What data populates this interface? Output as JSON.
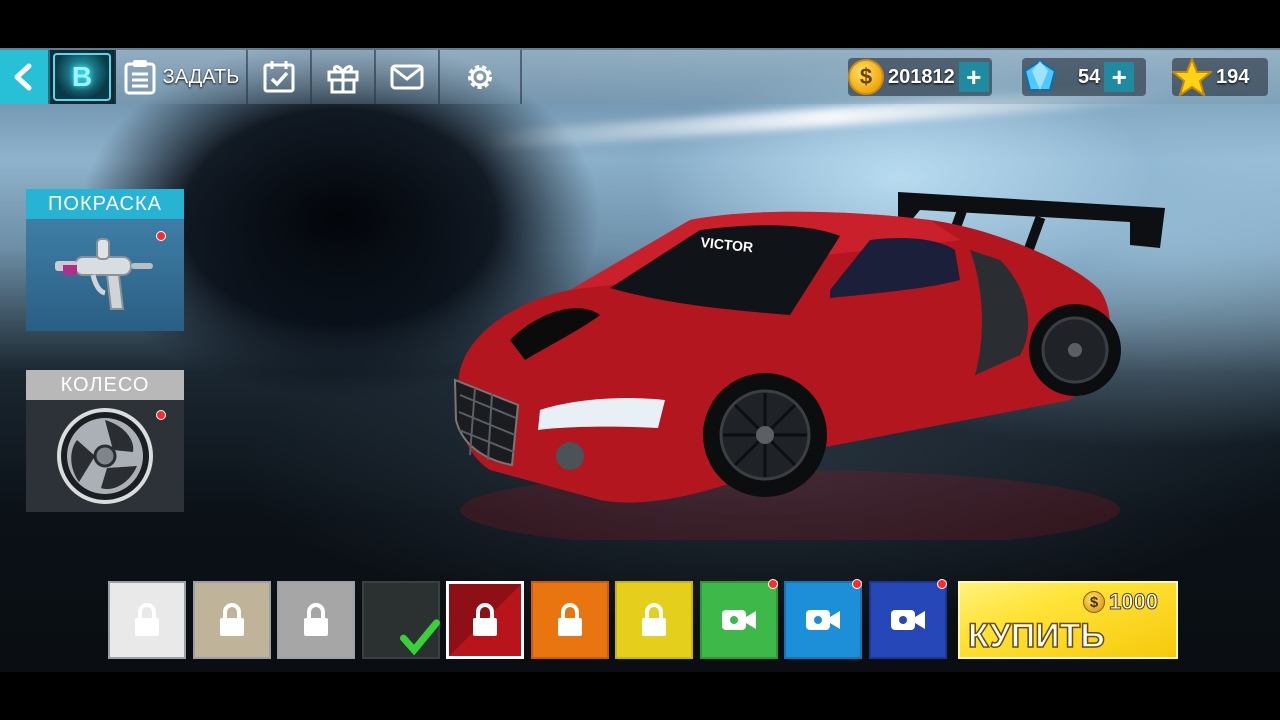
{
  "topbar": {
    "back_icon": "back-arrow-icon",
    "badge_letter": "B",
    "task_label": "ЗАДАТЬ",
    "icons": [
      "clipboard-icon",
      "calendar-check-icon",
      "gift-icon",
      "mail-icon",
      "settings-gear-icon"
    ]
  },
  "currencies": {
    "coins": "201812",
    "gems": "54",
    "stars": "194"
  },
  "side_panel": {
    "paint": {
      "label": "ПОКРАСКА",
      "icon": "spray-gun-icon",
      "has_notification": true
    },
    "wheel": {
      "label": "КОЛЕСО",
      "icon": "wheel-rim-icon",
      "has_notification": true
    }
  },
  "car": {
    "windshield_text": "VICTOR",
    "color": "#b3161f"
  },
  "swatches": [
    {
      "color": "#e9e9e9",
      "state": "locked"
    },
    {
      "color": "#bfb39a",
      "state": "locked"
    },
    {
      "color": "#a6a6a6",
      "state": "locked"
    },
    {
      "color": "#2b3030",
      "state": "owned-selected"
    },
    {
      "color": "#8e1016",
      "state": "locked-current"
    },
    {
      "color": "#e87510",
      "state": "locked"
    },
    {
      "color": "#e3cf1c",
      "state": "locked"
    },
    {
      "color": "#3fb84a",
      "state": "video",
      "has_notification": true
    },
    {
      "color": "#1d8fd8",
      "state": "video",
      "has_notification": true
    },
    {
      "color": "#2647b8",
      "state": "video",
      "has_notification": true
    }
  ],
  "buy": {
    "price": "1000",
    "label": "КУПИТЬ"
  }
}
